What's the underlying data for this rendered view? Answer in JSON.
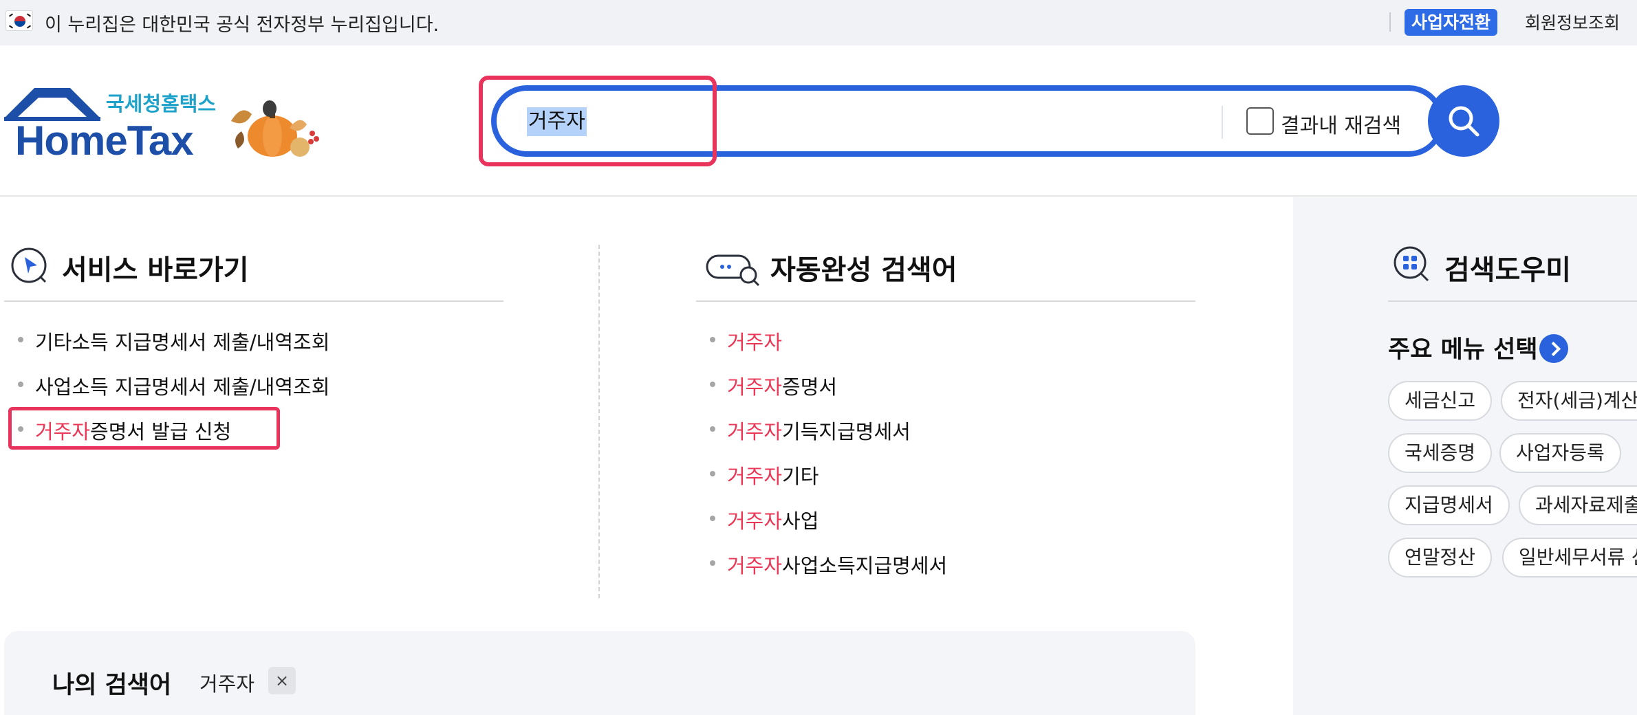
{
  "gov_banner": {
    "text": "이 누리집은 대한민국 공식 전자정부 누리집입니다.",
    "business_switch": "사업자전환",
    "member_info": "회원정보조회"
  },
  "logo": {
    "agency": "국세청홈택스",
    "brand": "HomeTax"
  },
  "search": {
    "query": "거주자",
    "research_label": "결과내 재검색",
    "research_checked": false
  },
  "service_shortcuts": {
    "title": "서비스 바로가기",
    "items": [
      {
        "highlight": "",
        "rest": "기타소득 지급명세서 제출/내역조회"
      },
      {
        "highlight": "",
        "rest": "사업소득 지급명세서 제출/내역조회"
      },
      {
        "highlight": "거주자",
        "rest": "증명서 발급 신청"
      }
    ]
  },
  "autocomplete": {
    "title": "자동완성 검색어",
    "items": [
      {
        "highlight": "거주자",
        "rest": ""
      },
      {
        "highlight": "거주자",
        "rest": "증명서"
      },
      {
        "highlight": "거주자",
        "rest": "기득지급명세서"
      },
      {
        "highlight": "거주자",
        "rest": "기타"
      },
      {
        "highlight": "거주자",
        "rest": "사업"
      },
      {
        "highlight": "거주자",
        "rest": "사업소득지급명세서"
      }
    ]
  },
  "search_helper": {
    "title": "검색도우미",
    "menu_select_label": "주요 메뉴 선택",
    "chips": [
      [
        "세금신고",
        "전자(세금)계산서"
      ],
      [
        "국세증명",
        "사업자등록"
      ],
      [
        "지급명세서",
        "과세자료제출"
      ],
      [
        "연말정산",
        "일반세무서류 신청"
      ]
    ]
  },
  "my_search": {
    "title": "나의 검색어",
    "keywords": [
      "거주자"
    ],
    "delete_symbol": "×"
  },
  "colors": {
    "primary": "#2a62dd",
    "highlight": "#ea3756",
    "focus": "#e8345c"
  }
}
